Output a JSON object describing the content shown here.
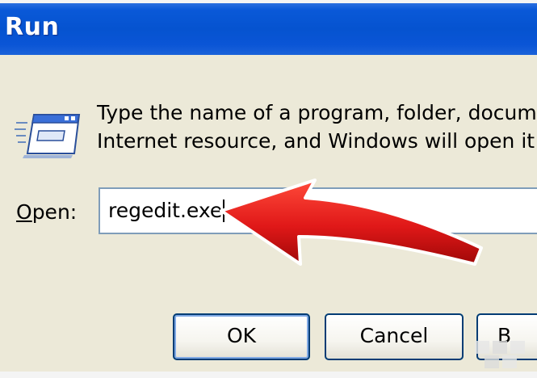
{
  "window": {
    "title": "Run",
    "description_line1": "Type the name of a program, folder, document, o",
    "description_line2": "Internet resource, and Windows will open it for y"
  },
  "open_field": {
    "label": "Open:",
    "label_accesskey": "O",
    "label_rest": "pen:",
    "value": "regedit.exe"
  },
  "buttons": {
    "ok": "OK",
    "cancel": "Cancel",
    "browse": "B"
  },
  "colors": {
    "titlebar": "#0553d0",
    "client_background": "#ece9d8",
    "arrow": "#e01818",
    "button_border": "#003c74"
  },
  "icons": {
    "run_icon": "run-window-icon",
    "annotation": "red-arrow-annotation"
  }
}
